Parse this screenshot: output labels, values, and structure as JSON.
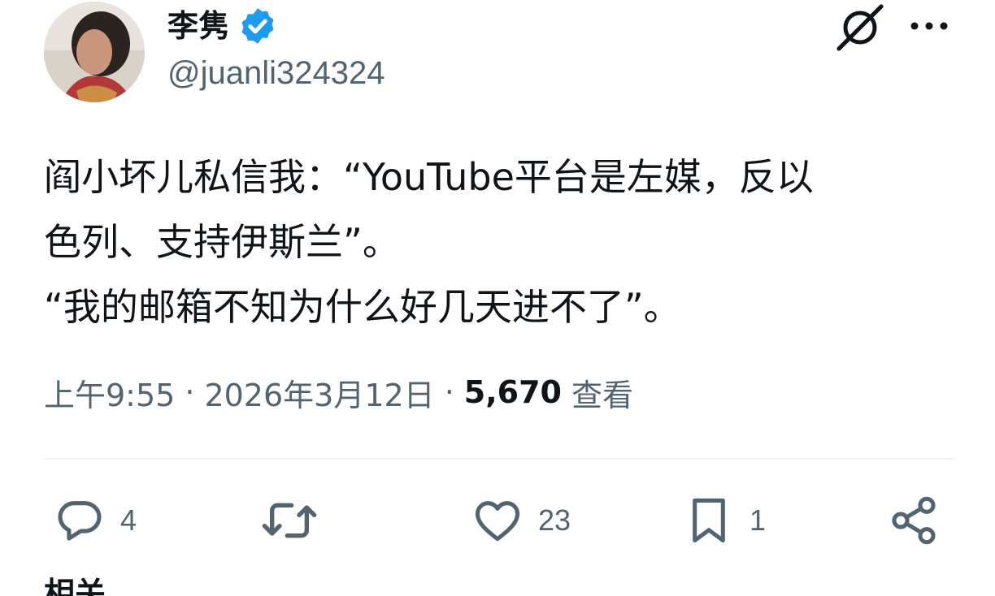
{
  "author": {
    "display_name": "李隽",
    "handle": "@juanli324324",
    "verified_icon": "verified-badge-icon",
    "verified_color": "#1d9bf0"
  },
  "tweet": {
    "lines": [
      "阎小坏儿私信我：“YouTube平台是左媒，反以",
      "色列、支持伊斯兰”。",
      "“我的邮箱不知为什么好几天进不了”。"
    ]
  },
  "meta": {
    "time": "上午9:55",
    "separator": "·",
    "date": "2026年3月12日",
    "views_count": "5,670",
    "views_label": "查看"
  },
  "actions": {
    "reply_count": "4",
    "retweet_count": "",
    "like_count": "23",
    "bookmark_count": "1"
  },
  "icons": {
    "grok": "grok-icon",
    "more": "more-icon",
    "reply": "reply-icon",
    "retweet": "retweet-icon",
    "like": "heart-icon",
    "bookmark": "bookmark-icon",
    "share": "share-icon"
  },
  "section": {
    "related_label": "相关"
  },
  "colors": {
    "text": "#0f1419",
    "secondary": "#536471",
    "divider": "#eff3f4"
  }
}
